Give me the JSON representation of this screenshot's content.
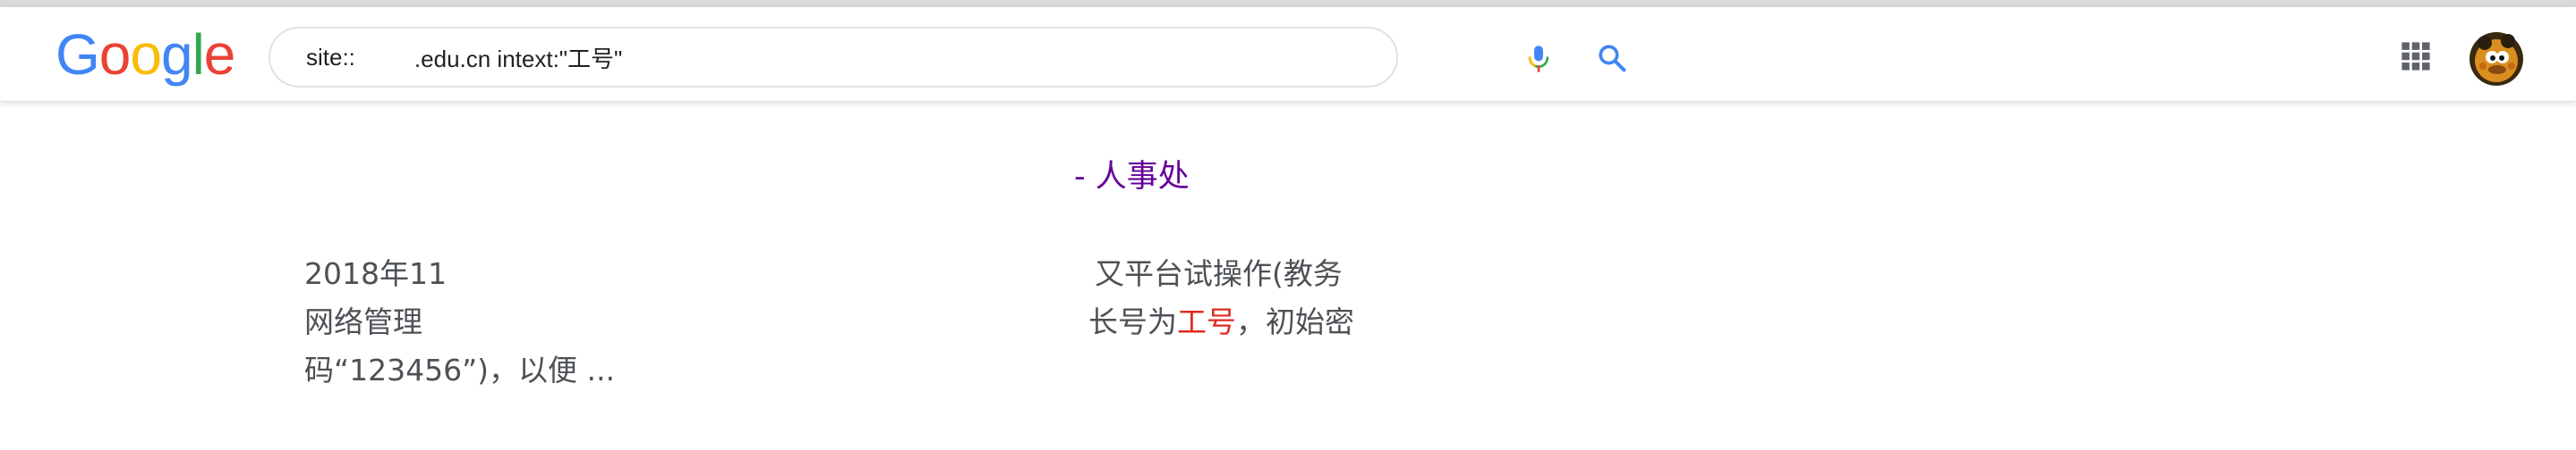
{
  "header": {
    "logo": {
      "letters": [
        "G",
        "o",
        "o",
        "g",
        "l",
        "e"
      ],
      "colors": [
        "#4285F4",
        "#EA4335",
        "#FBBC05",
        "#4285F4",
        "#34A853",
        "#EA4335"
      ]
    },
    "search": {
      "value_left": "site::",
      "value_right": ".edu.cn intext:\"工号\""
    },
    "icons": {
      "mic": "mic-icon",
      "search": "search-icon",
      "apps": "apps-grid-icon",
      "avatar": "user-avatar"
    }
  },
  "result": {
    "title": "- 人事处",
    "snippet": {
      "line1_left": "2018年11",
      "line1_right": "又平台试操作(教务",
      "line2_left": "网络管理",
      "line2_mid": "长号为",
      "line2_em": "工号",
      "line2_right": "，初始密",
      "line3": "码“123456”)，以便 ..."
    }
  },
  "colors": {
    "title_visited": "#660099",
    "snippet_text": "#4d5156",
    "highlight": "#dd2c1f",
    "search_blue": "#4285F4"
  }
}
